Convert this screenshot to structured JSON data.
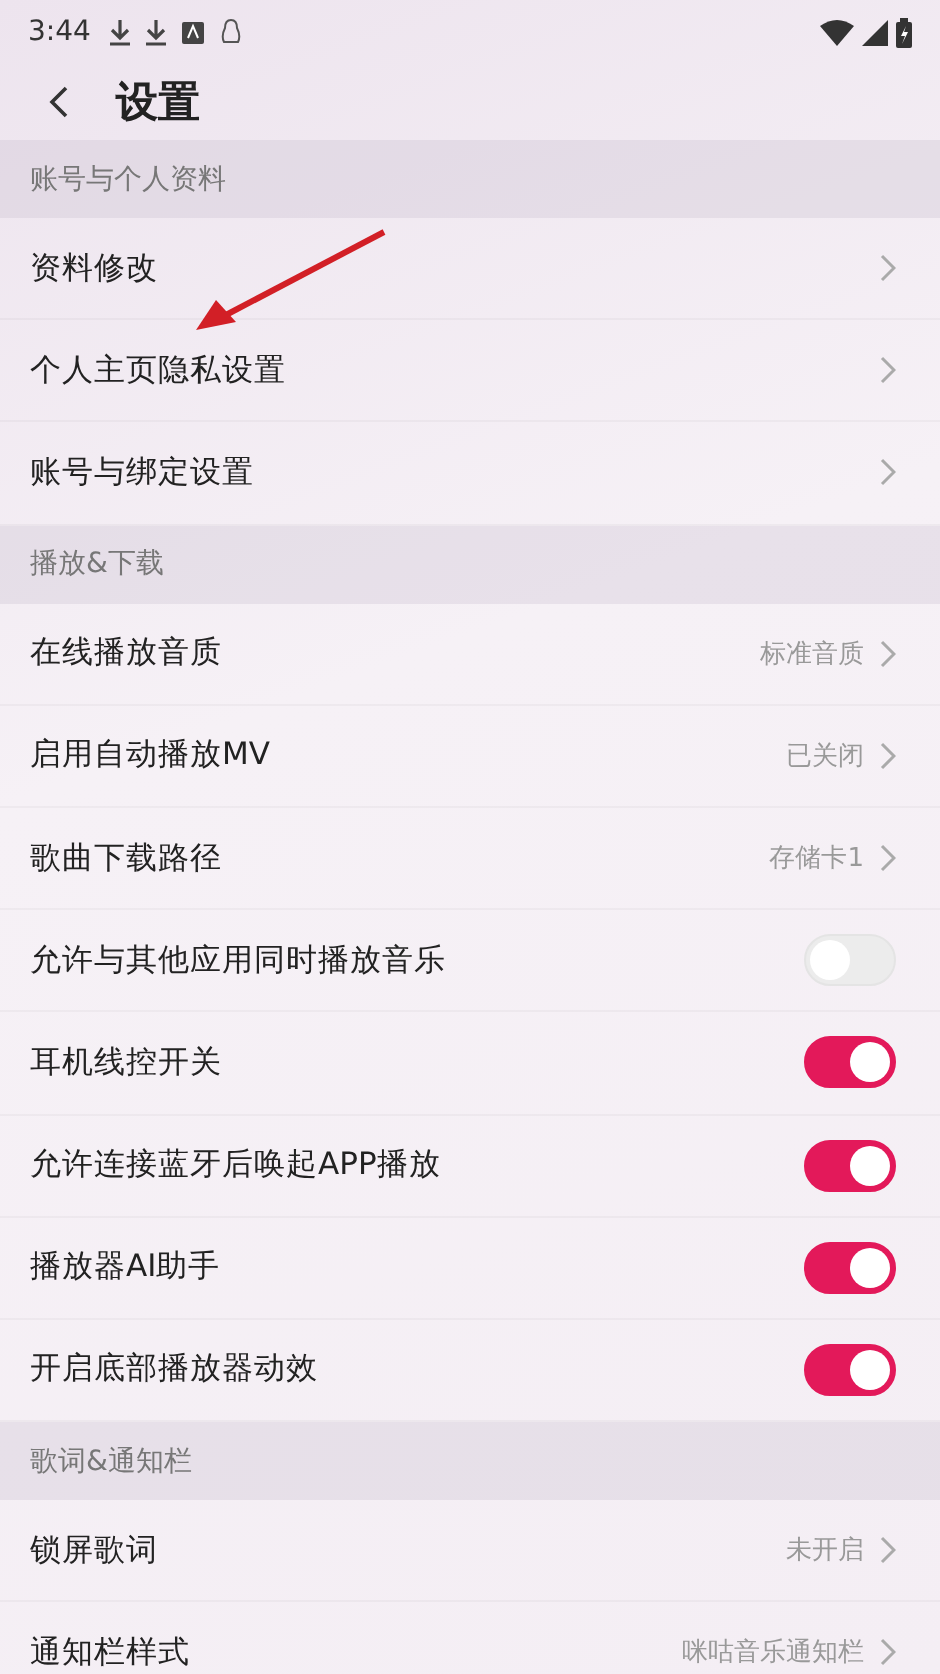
{
  "status_bar": {
    "time": "3:44"
  },
  "header": {
    "title": "设置"
  },
  "sections": [
    {
      "title": "账号与个人资料",
      "rows": [
        {
          "kind": "link",
          "label": "资料修改"
        },
        {
          "kind": "link",
          "label": "个人主页隐私设置"
        },
        {
          "kind": "link",
          "label": "账号与绑定设置"
        }
      ]
    },
    {
      "title": "播放&下载",
      "rows": [
        {
          "kind": "link",
          "label": "在线播放音质",
          "value": "标准音质"
        },
        {
          "kind": "link",
          "label": "启用自动播放MV",
          "value": "已关闭"
        },
        {
          "kind": "link",
          "label": "歌曲下载路径",
          "value": "存储卡1"
        },
        {
          "kind": "toggle",
          "label": "允许与其他应用同时播放音乐",
          "on": false
        },
        {
          "kind": "toggle",
          "label": "耳机线控开关",
          "on": true
        },
        {
          "kind": "toggle",
          "label": "允许连接蓝牙后唤起APP播放",
          "on": true
        },
        {
          "kind": "toggle",
          "label": "播放器AI助手",
          "on": true
        },
        {
          "kind": "toggle",
          "label": "开启底部播放器动效",
          "on": true
        }
      ]
    },
    {
      "title": "歌词&通知栏",
      "rows": [
        {
          "kind": "link",
          "label": "锁屏歌词",
          "value": "未开启"
        },
        {
          "kind": "link",
          "label": "通知栏样式",
          "value": "咪咕音乐通知栏"
        }
      ]
    }
  ]
}
